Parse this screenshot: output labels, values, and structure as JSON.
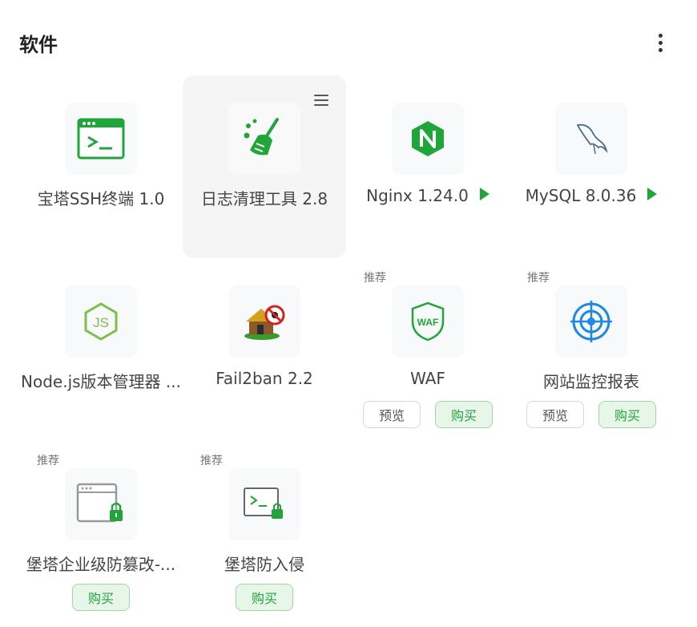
{
  "header": {
    "title": "软件"
  },
  "apps": [
    {
      "name": "宝塔SSH终端 1.0",
      "icon": "terminal-icon",
      "running": false
    },
    {
      "name": "日志清理工具 2.8",
      "icon": "broom-icon",
      "running": false
    },
    {
      "name": "Nginx 1.24.0",
      "icon": "nginx-icon",
      "running": true
    },
    {
      "name": "MySQL 8.0.36",
      "icon": "mysql-dolphin-icon",
      "running": true
    },
    {
      "name": "Node.js版本管理器 ...",
      "icon": "nodejs-icon"
    },
    {
      "name": "Fail2ban 2.2",
      "icon": "fail2ban-icon"
    },
    {
      "name": "WAF",
      "icon": "waf-shield-icon",
      "tag": "推荐",
      "preview_label": "预览",
      "buy_label": "购买"
    },
    {
      "name": "网站监控报表",
      "icon": "target-icon",
      "tag": "推荐",
      "preview_label": "预览",
      "buy_label": "购买"
    },
    {
      "name": "堡塔企业级防篡改-...",
      "icon": "window-lock-icon",
      "tag": "推荐",
      "buy_label": "购买"
    },
    {
      "name": "堡塔防入侵",
      "icon": "terminal-lock-icon",
      "tag": "推荐",
      "buy_label": "购买"
    }
  ],
  "colors": {
    "accent": "#20a53a",
    "buy_bg": "#e8f6ea"
  }
}
